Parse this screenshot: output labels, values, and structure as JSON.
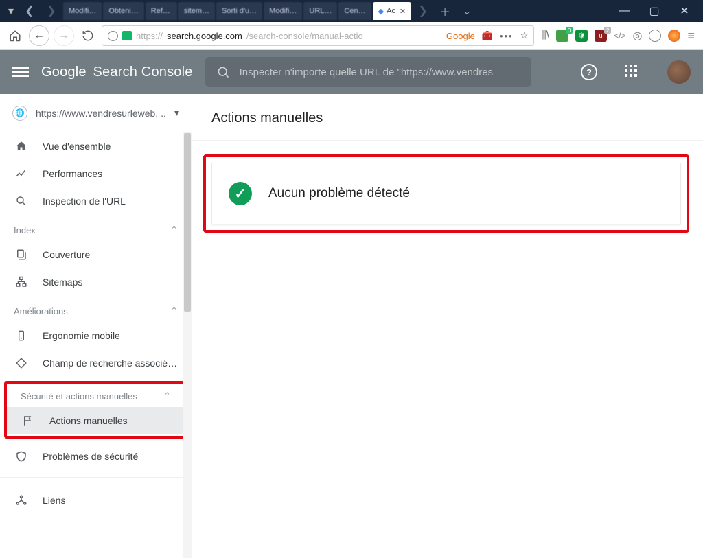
{
  "browser": {
    "tabs": [
      {
        "label": "Modifi…"
      },
      {
        "label": "Obteni…"
      },
      {
        "label": "Ref…"
      },
      {
        "label": "sitem…"
      },
      {
        "label": "Sorti d'u…"
      },
      {
        "label": "Modifi…"
      },
      {
        "label": "URL…"
      },
      {
        "label": "Cen…"
      },
      {
        "label": "Ac",
        "active": true
      }
    ],
    "url_prefix": "https://",
    "url_host": "search.google.com",
    "url_path": "/search-console/manual-actio",
    "addr_label": "Google",
    "ext_badge_1": "0",
    "ext_badge_2": "2"
  },
  "gsc": {
    "logo_a": "Google",
    "logo_b": "Search Console",
    "search_placeholder": "Inspecter n'importe quelle URL de \"https://www.vendres",
    "help": "?"
  },
  "property": {
    "label": "https://www.vendresurleweb. ..",
    "dropdown": "▾"
  },
  "nav": {
    "overview": "Vue d'ensemble",
    "performance": "Performances",
    "url_inspection": "Inspection de l'URL",
    "section_index": "Index",
    "coverage": "Couverture",
    "sitemaps": "Sitemaps",
    "section_enhance": "Améliorations",
    "mobile": "Ergonomie mobile",
    "sitelinks": "Champ de recherche associé…",
    "section_security": "Sécurité et actions manuelles",
    "manual_actions": "Actions manuelles",
    "security_issues": "Problèmes de sécurité",
    "links": "Liens",
    "chev": "⌃"
  },
  "page": {
    "title": "Actions manuelles",
    "status": "Aucun problème détecté",
    "check": "✓"
  }
}
